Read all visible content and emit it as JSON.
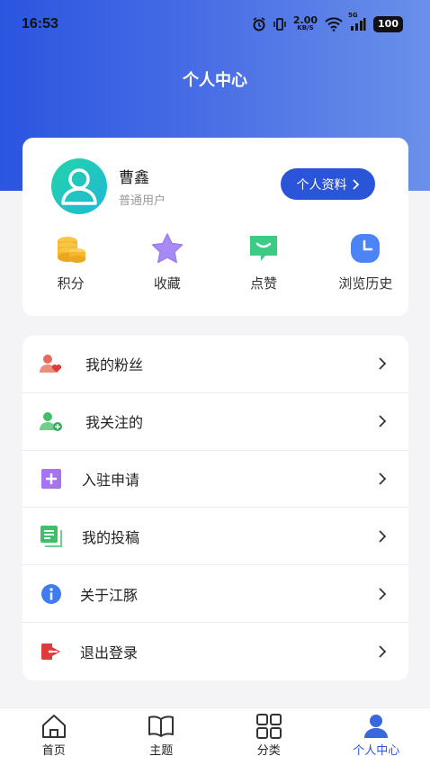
{
  "status_bar": {
    "time": "16:53",
    "net_speed_value": "2.00",
    "net_speed_unit": "KB/S",
    "network": "5G",
    "battery": "100"
  },
  "header": {
    "title": "个人中心",
    "accent_color": "#2a55d8"
  },
  "profile": {
    "name": "曹鑫",
    "role": "普通用户",
    "profile_button": "个人资料",
    "avatar_icon": "user-avatar-icon"
  },
  "stats": [
    {
      "label": "积分",
      "icon": "coins-icon",
      "color": "#f5b82e"
    },
    {
      "label": "收藏",
      "icon": "star-icon",
      "color": "#9b7ff0"
    },
    {
      "label": "点赞",
      "icon": "chat-like-icon",
      "color": "#3ccb84"
    },
    {
      "label": "浏览历史",
      "icon": "clock-icon",
      "color": "#4a84f5"
    }
  ],
  "menu": [
    {
      "label": "我的粉丝",
      "icon": "fans-icon",
      "color": "#e86a5a"
    },
    {
      "label": "我关注的",
      "icon": "follow-icon",
      "color": "#3fbf6a"
    },
    {
      "label": "入驻申请",
      "icon": "apply-plus-icon",
      "color": "#a575f0"
    },
    {
      "label": "我的投稿",
      "icon": "document-icon",
      "color": "#3fbf6a"
    },
    {
      "label": "关于江豚",
      "icon": "info-icon",
      "color": "#3f7cf0"
    },
    {
      "label": "退出登录",
      "icon": "logout-icon",
      "color": "#e03a3a"
    }
  ],
  "tabs": [
    {
      "label": "首页",
      "icon": "home-icon"
    },
    {
      "label": "主题",
      "icon": "book-icon"
    },
    {
      "label": "分类",
      "icon": "grid-icon"
    },
    {
      "label": "个人中心",
      "icon": "person-icon",
      "active": true
    }
  ]
}
